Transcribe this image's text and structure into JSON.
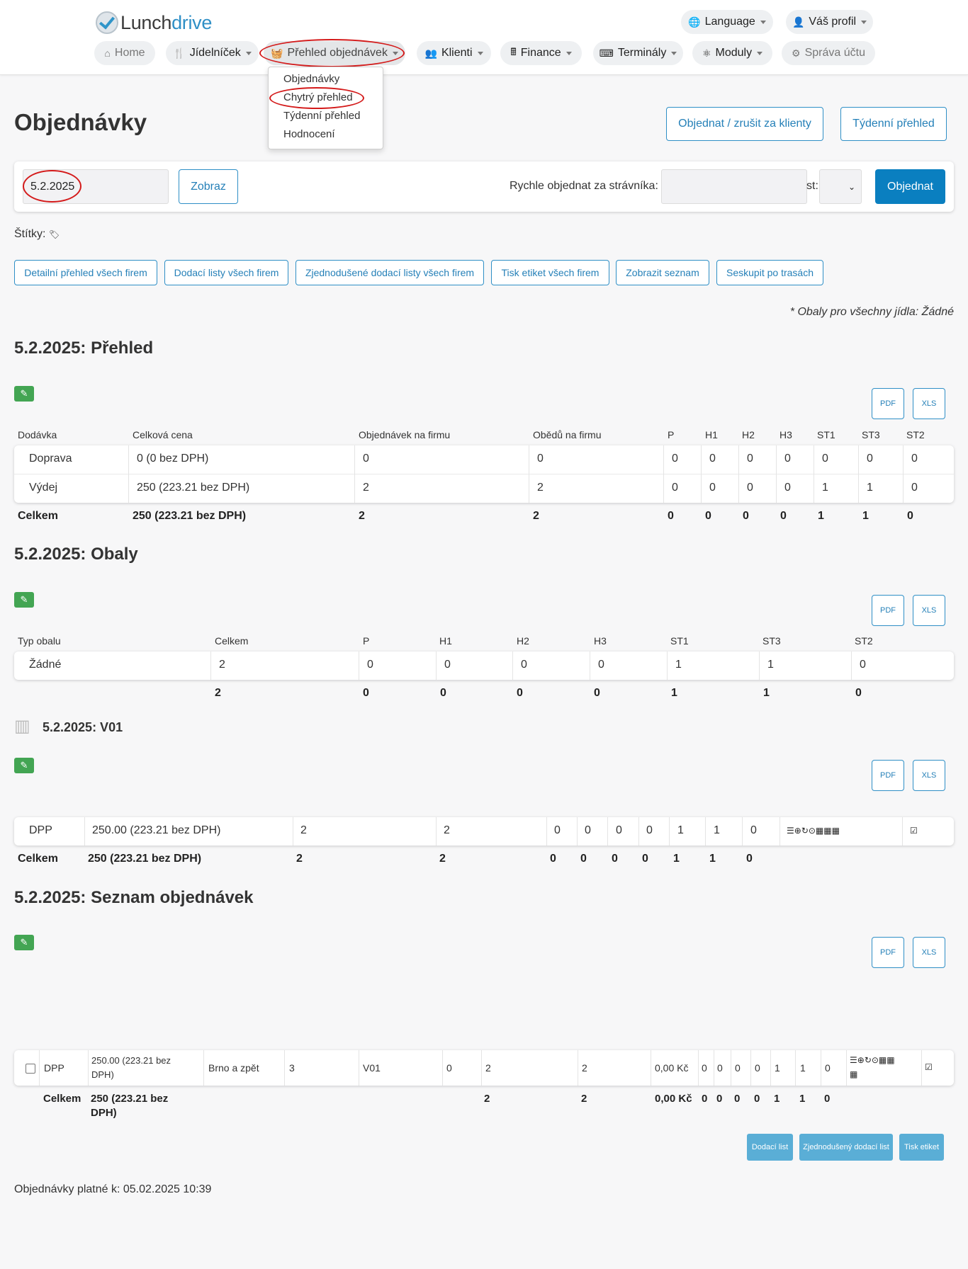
{
  "nav": {
    "logo_a": "Lunch",
    "logo_b": "drive",
    "language": "Language",
    "profile": "Váš profil",
    "home": "Home",
    "menu": "Jídelníček",
    "orders": "Přehled objednávek",
    "clients": "Klienti",
    "finance": "Finance",
    "terminals": "Terminály",
    "modules": "Moduly",
    "account": "Správa účtu"
  },
  "dropdown": [
    "Objednávky",
    "Chytrý přehled",
    "Týdenní přehled",
    "Hodnocení"
  ],
  "page": {
    "title": "Objednávky",
    "btn_order_for_clients": "Objednat / zrušit za klienty",
    "btn_weekly": "Týdenní přehled"
  },
  "filter": {
    "date": "5.2.2025",
    "show": "Zobraz",
    "quick_label": "Rychle objednat za strávníka:",
    "st_label": "st:",
    "order": "Objednat"
  },
  "tags_label": "Štítky:",
  "section_buttons": [
    "Detailní přehled všech firem",
    "Dodací listy všech firem",
    "Zjednodušené dodací listy všech firem",
    "Tisk etiket všech firem",
    "Zobrazit seznam",
    "Seskupit po trasách"
  ],
  "packaging_note": "* Obaly pro všechny jídla: Žádné",
  "pdf": "PDF",
  "xls": "XLS",
  "overview": {
    "title": "5.2.2025: Přehled",
    "headers": [
      "Dodávka",
      "Celková cena",
      "Objednávek na firmu",
      "Obědů na firmu",
      "P",
      "H1",
      "H2",
      "H3",
      "ST1",
      "ST3",
      "ST2"
    ],
    "rows": [
      [
        "Doprava",
        "0 (0 bez DPH)",
        "0",
        "0",
        "0",
        "0",
        "0",
        "0",
        "0",
        "0",
        "0"
      ],
      [
        "Výdej",
        "250 (223.21 bez DPH)",
        "2",
        "2",
        "0",
        "0",
        "0",
        "0",
        "1",
        "1",
        "0"
      ]
    ],
    "total": [
      "Celkem",
      "250 (223.21 bez DPH)",
      "2",
      "2",
      "0",
      "0",
      "0",
      "0",
      "1",
      "1",
      "0"
    ]
  },
  "packaging": {
    "title": "5.2.2025: Obaly",
    "headers": [
      "Typ obalu",
      "Celkem",
      "P",
      "H1",
      "H2",
      "H3",
      "ST1",
      "ST3",
      "ST2"
    ],
    "row": [
      "Žádné",
      "2",
      "0",
      "0",
      "0",
      "0",
      "1",
      "1",
      "0"
    ],
    "total": [
      "2",
      "0",
      "0",
      "0",
      "0",
      "1",
      "1",
      "0"
    ]
  },
  "company": {
    "title": "5.2.2025: V01",
    "row": [
      "DPP",
      "250.00 (223.21 bez DPH)",
      "2",
      "2",
      "0",
      "0",
      "0",
      "0",
      "1",
      "1",
      "0"
    ],
    "icons": "☰⊕↻⊙▦▦▦",
    "total": [
      "Celkem",
      "250 (223.21 bez DPH)",
      "2",
      "2",
      "0",
      "0",
      "0",
      "0",
      "1",
      "1",
      "0"
    ]
  },
  "order_list": {
    "title": "5.2.2025: Seznam objednávek",
    "row": {
      "client": "DPP",
      "price_a": "250.00 (223.21 bez",
      "price_b": "DPH)",
      "route": "Brno a zpět",
      "route_no": "3",
      "company": "V01",
      "c0": "0",
      "c1": "2",
      "c2": "2",
      "money": "0,00 Kč",
      "v": [
        "0",
        "0",
        "0",
        "0",
        "1",
        "1",
        "0"
      ],
      "icons_a": "☰⊕↻⊙▦▦",
      "icons_b": "▦"
    },
    "total": {
      "label": "Celkem",
      "price_a": "250 (223.21 bez",
      "price_b": "DPH)",
      "c1": "2",
      "c2": "2",
      "money": "0,00 Kč",
      "v": [
        "0",
        "0",
        "0",
        "0",
        "1",
        "1",
        "0"
      ]
    },
    "buttons": [
      "Dodací list",
      "Zjednodušený dodací list",
      "Tisk etiket"
    ]
  },
  "footer": "Objednávky platné k: 05.02.2025 10:39"
}
